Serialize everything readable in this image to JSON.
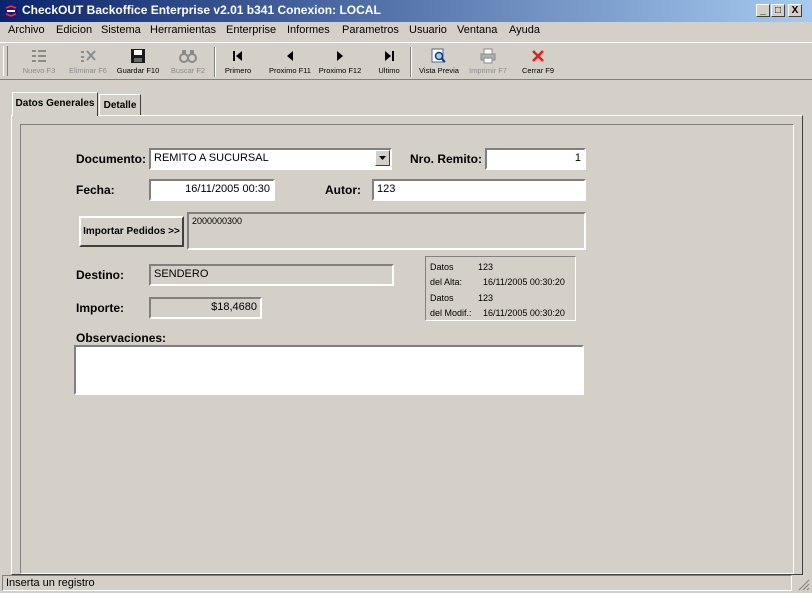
{
  "window": {
    "title": "CheckOUT Backoffice Enterprise v2.01 b341 Conexion: LOCAL",
    "minimize": "_",
    "maximize": "□",
    "close": "X"
  },
  "menu": [
    "Archivo",
    "Edicion",
    "Sistema",
    "Herramientas",
    "Enterprise",
    "Informes",
    "Parametros",
    "Usuario",
    "Ventana",
    "Ayuda"
  ],
  "toolbar": {
    "nuevo": "Nuevo F3",
    "eliminar": "Eliminar F6",
    "guardar": "Guardar F10",
    "buscar": "Buscar F2",
    "primero": "Primero",
    "proximo_f11": "Proximo F11",
    "proximo_f12": "Proximo F12",
    "ultimo": "Ultimo",
    "vista_previa": "Vista Previa",
    "imprimir": "Imprimir F7",
    "cerrar": "Cerrar F9"
  },
  "tabs": {
    "datos_generales": "Datos Generales",
    "detalle": "Detalle"
  },
  "form": {
    "documento_label": "Documento:",
    "documento_value": "REMITO A SUCURSAL",
    "nro_remito_label": "Nro. Remito:",
    "nro_remito_value": "1",
    "fecha_label": "Fecha:",
    "fecha_value": "16/11/2005 00:30",
    "autor_label": "Autor:",
    "autor_value": "123",
    "importar_button": "Importar Pedidos >>",
    "pedidos_value": "2000000300",
    "destino_label": "Destino:",
    "destino_value": "SENDERO",
    "importe_label": "Importe:",
    "importe_value": "$18,4680",
    "observaciones_label": "Observaciones:",
    "observaciones_value": ""
  },
  "info": {
    "alta_label1": "Datos",
    "alta_label2": "del Alta:",
    "alta_user": "123",
    "alta_date": "16/11/2005 00:30:20",
    "modif_label1": "Datos",
    "modif_label2": "del Modif.:",
    "modif_user": "123",
    "modif_date": "16/11/2005 00:30:20"
  },
  "status": {
    "text": "Inserta un registro"
  },
  "colors": {
    "titlebar_start": "#0a246a",
    "titlebar_end": "#a6caf0",
    "face": "#d4d0c8",
    "close_icon": "#e02020"
  }
}
